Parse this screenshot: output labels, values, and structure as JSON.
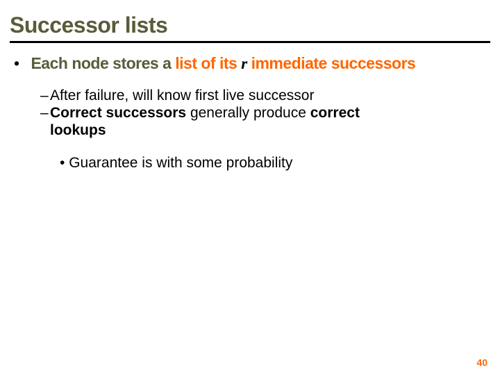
{
  "title": "Successor lists",
  "bullet1": {
    "prefix": "Each node stores a",
    "list_of_its": "list of its",
    "r": "r",
    "tail": "immediate successors"
  },
  "sub": {
    "line1": "After failure, will know first live successor",
    "line2_a": "Correct successors",
    "line2_b": " generally produce ",
    "line2_c": "correct",
    "line2_d": "lookups"
  },
  "sub2": "Guarantee is with some probability",
  "page": "40"
}
